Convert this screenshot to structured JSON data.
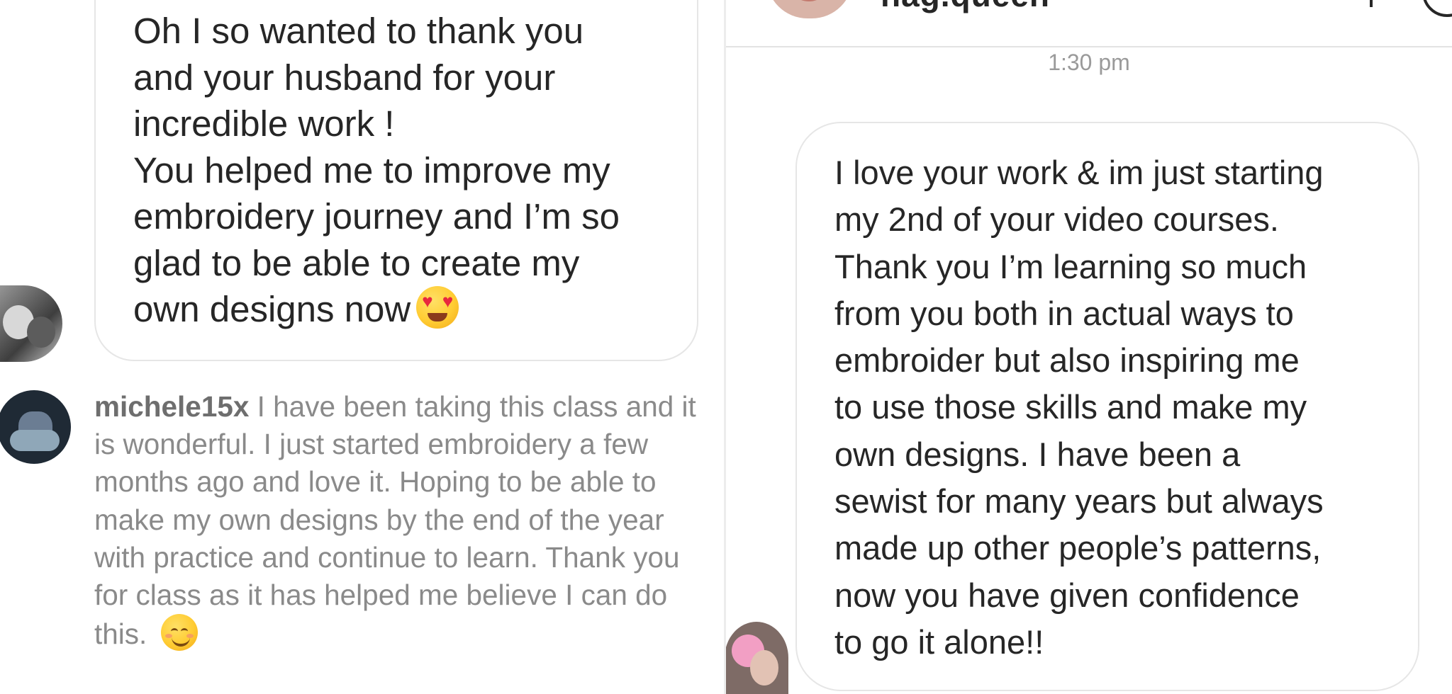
{
  "left_panel": {
    "dm_message": "Oh I so wanted to thank you\nand your husband for your\nincredible work !\nYou helped me to improve my\nembroidery journey and I’m so\nglad to be able to create my\nown designs now",
    "dm_emoji": "heart-eyes-emoji",
    "comment": {
      "username": "michele15x",
      "text": " I have been taking this class and it is wonderful.  I just started embroidery a few months ago and love it.  Hoping to be able to make my own designs by the end of the year with practice and continue to learn.  Thank you for class as it has helped me believe I can do this.",
      "emoji": "smiling-face-emoji"
    }
  },
  "right_panel": {
    "header_username": "nag.queen",
    "timestamp": "1:30 pm",
    "dm_message": "I love your work & im just starting\nmy 2nd of your video courses.\nThank you I’m learning so much\nfrom you both in actual ways to\nembroider but also inspiring me\nto use those skills and make my\nown designs. I have been a\nsewist for many years but always\nmade up other people’s patterns,\nnow you have given confidence\nto go it alone!!"
  },
  "colors": {
    "text": "#262626",
    "comment_text": "#8a8a8a",
    "bubble_border": "#e6e6e6",
    "timestamp": "#9a9a9a"
  }
}
